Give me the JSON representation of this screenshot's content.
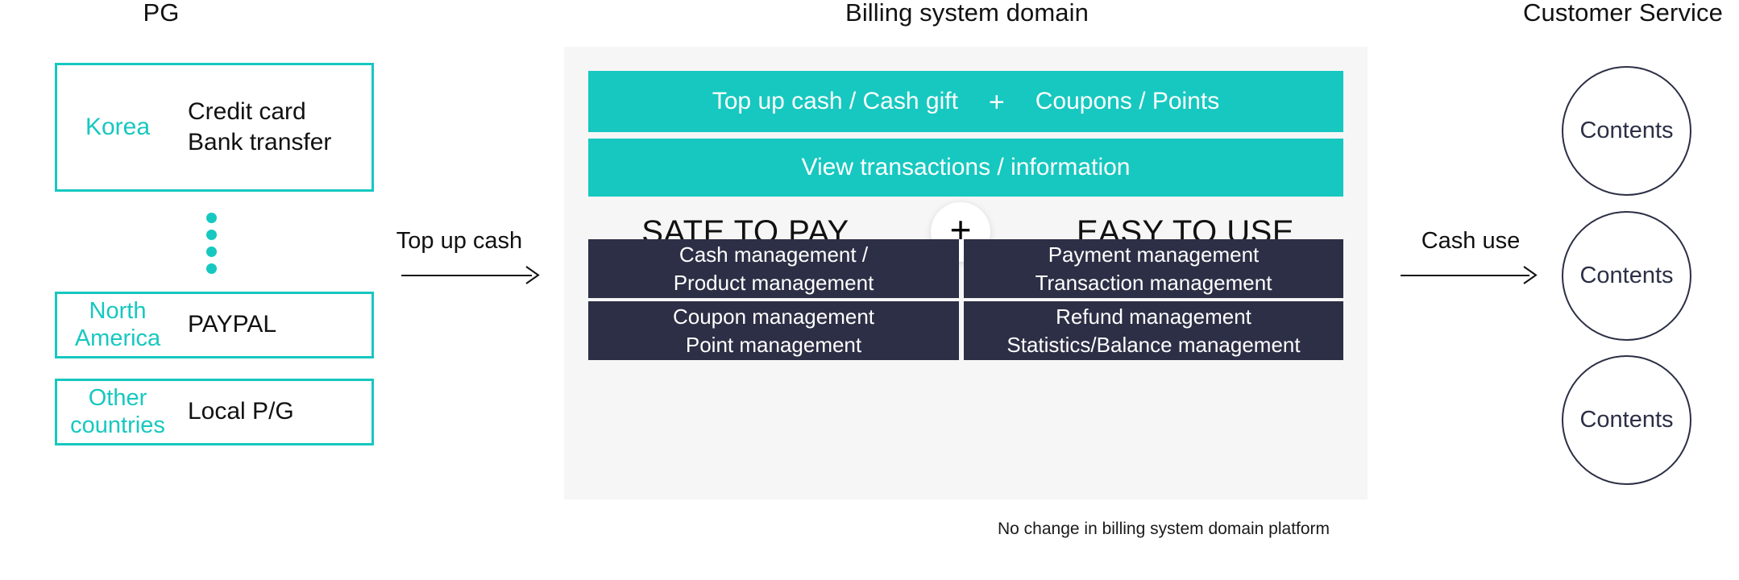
{
  "colors": {
    "teal": "#16C8C0",
    "navy": "#2C2F45",
    "panel_bg": "#F6F6F7",
    "text": "#111111",
    "white": "#FFFFFF"
  },
  "columns": {
    "left_title": "PG",
    "center_title": "Billing system domain",
    "right_title": "Customer Service"
  },
  "pg": {
    "boxes": [
      {
        "region": "Korea",
        "methods": "Credit card\nBank transfer"
      },
      {
        "region": "North\nAmerica",
        "methods": "PAYPAL"
      },
      {
        "region": "Other\ncountries",
        "methods": "Local P/G"
      }
    ],
    "ellipsis_dots": 4
  },
  "arrows": {
    "left": {
      "label": "Top up cash"
    },
    "right": {
      "label": "Cash use"
    }
  },
  "billing": {
    "teal_bar_top": {
      "left_text": "Top up cash / Cash gift",
      "plus": "+",
      "right_text": "Coupons / Points"
    },
    "teal_bar_bottom": {
      "text": "View transactions  /  information"
    },
    "slogan": {
      "left": "SATE TO PAY",
      "badge": "+",
      "right": "EASY TO USE"
    },
    "cards": [
      "Cash management /\nProduct management",
      "Payment management\nTransaction management",
      "Coupon management\nPoint management",
      "Refund management\nStatistics/Balance management"
    ]
  },
  "customer_service": {
    "circles": [
      {
        "label": "Contents"
      },
      {
        "label": "Contents"
      },
      {
        "label": "Contents"
      }
    ]
  },
  "footnote": "No change in billing system domain platform"
}
